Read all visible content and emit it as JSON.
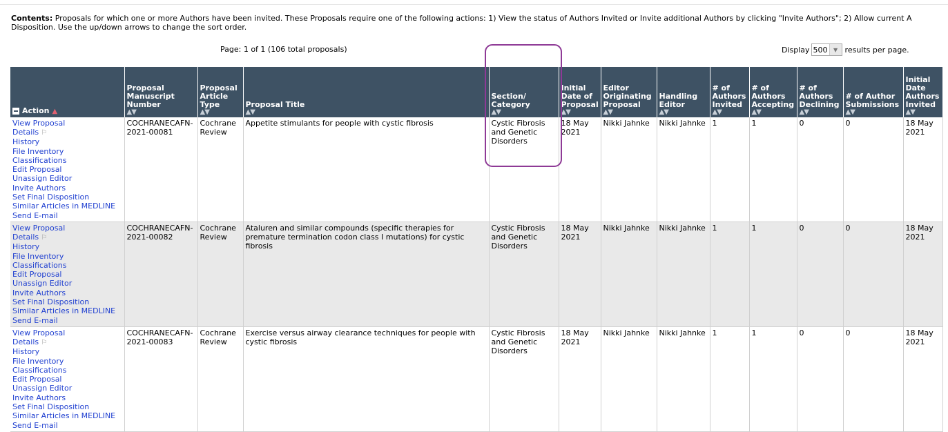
{
  "contents": {
    "label": "Contents:",
    "text": "Proposals for which one or more Authors have been invited. These Proposals require one of the following actions: 1) View the status of Authors Invited or Invite additional Authors by clicking \"Invite Authors\"; 2) Allow current A",
    "text2": "Disposition. Use the up/down arrows to change the sort order."
  },
  "pager": {
    "text": "Page: 1 of 1 (106 total proposals)"
  },
  "display": {
    "label": "Display",
    "value": "500",
    "suffix": "results per page."
  },
  "headers": {
    "action": "Action",
    "manuscript": "Proposal Manuscript Number",
    "article_type": "Proposal Article Type",
    "title": "Proposal Title",
    "section": "Section/ Category",
    "initial_date": "Initial Date of Proposal",
    "editor_orig": "Editor Originating Proposal",
    "handling": "Handling Editor",
    "invited": "# of Authors Invited",
    "accepting": "# of Authors Accepting",
    "declining": "# of Authors Declining",
    "submissions": "# of Author Submissions",
    "initial_invited": "Initial Date Authors Invited"
  },
  "action_links": [
    "View Proposal",
    "Details",
    "History",
    "File Inventory",
    "Classifications",
    "Edit Proposal",
    "Unassign Editor",
    "Invite Authors",
    "Set Final Disposition",
    "Similar Articles in MEDLINE",
    "Send E-mail"
  ],
  "rows": [
    {
      "manuscript": "COCHRANECAFN-2021-00081",
      "article_type": "Cochrane Review",
      "title": "Appetite stimulants for people with cystic fibrosis",
      "section": "Cystic Fibrosis and Genetic Disorders",
      "initial_date": "18 May 2021",
      "editor_orig": "Nikki Jahnke",
      "handling": "Nikki Jahnke",
      "invited": "1",
      "accepting": "1",
      "declining": "0",
      "submissions": "0",
      "initial_invited": "18 May 2021"
    },
    {
      "manuscript": "COCHRANECAFN-2021-00082",
      "article_type": "Cochrane Review",
      "title": "Ataluren and similar compounds (specific therapies for premature termination codon class I mutations) for cystic fibrosis",
      "section": "Cystic Fibrosis and Genetic Disorders",
      "initial_date": "18 May 2021",
      "editor_orig": "Nikki Jahnke",
      "handling": "Nikki Jahnke",
      "invited": "1",
      "accepting": "1",
      "declining": "0",
      "submissions": "0",
      "initial_invited": "18 May 2021"
    },
    {
      "manuscript": "COCHRANECAFN-2021-00083",
      "article_type": "Cochrane Review",
      "title": "Exercise versus airway clearance techniques for people with cystic fibrosis",
      "section": "Cystic Fibrosis and Genetic Disorders",
      "initial_date": "18 May 2021",
      "editor_orig": "Nikki Jahnke",
      "handling": "Nikki Jahnke",
      "invited": "1",
      "accepting": "1",
      "declining": "0",
      "submissions": "0",
      "initial_invited": "18 May 2021"
    }
  ]
}
